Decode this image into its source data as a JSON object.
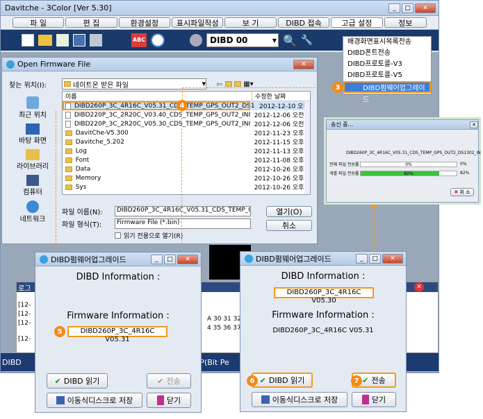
{
  "main": {
    "title": "Davitche - 3Color [Ver 5.30]",
    "menu": [
      "파 일",
      "편 집",
      "환경설정",
      "표시파일작성",
      "보 기",
      "DIBD 접속",
      "고급 설정",
      "정보"
    ],
    "dibd_label": "DIBD 00",
    "dropdown": [
      "배경화면표시목록전송",
      "DIBD폰트전송",
      "DIBD프로토콜-V3",
      "DIBD프로토콜-V5",
      "DIBD펌웨어업그레이드"
    ],
    "log_label": "로그",
    "log_lines": [
      "[12-",
      "[12-",
      "[12-",
      "[12-"
    ],
    "log_hex": [
      "A 30 31 32 33",
      "4 35 36 37 38"
    ],
    "status_left": "DIBD",
    "status_right": "PP(Bit Pe"
  },
  "open": {
    "title": "Open Firmware File",
    "look_in_label": "찾는 위치(I):",
    "look_in_value": "네이트온 받은 파일",
    "col_name": "이름",
    "col_date": "수정한 날짜",
    "files": [
      {
        "name": "DIBD260P_3C_4R16C_V05.31_CDS_TEMP_GPS_OUT2_DS1302_IN...",
        "date": "2012-12-10 오전",
        "kind": "file"
      },
      {
        "name": "DIBD220P_3C_2R20C_V03.40_CDS_TEMP_GPS_OUT2_IN8_DS130...",
        "date": "2012-12-06 오전 1",
        "kind": "file"
      },
      {
        "name": "DIBD220P_3C_2R20C_V05.30_CDS_TEMP_GPS_OUT2_IN8_DS130...",
        "date": "2012-12-06 오전 1",
        "kind": "file"
      },
      {
        "name": "DavitChe-V5.300",
        "date": "2012-11-23 오후 1",
        "kind": "folder"
      },
      {
        "name": "Davitche_5.202",
        "date": "2012-11-15 오후 1",
        "kind": "folder"
      },
      {
        "name": "Log",
        "date": "2012-11-13 오후 8",
        "kind": "folder"
      },
      {
        "name": "Font",
        "date": "2012-11-08 오후 1",
        "kind": "folder"
      },
      {
        "name": "Data",
        "date": "2012-10-26 오후 2",
        "kind": "folder"
      },
      {
        "name": "Memory",
        "date": "2012-10-26 오후 2",
        "kind": "folder"
      },
      {
        "name": "Sys",
        "date": "2012-10-26 오후 2",
        "kind": "folder"
      }
    ],
    "places": [
      "최근 위치",
      "바탕 화면",
      "라이브러리",
      "컴퓨터",
      "네트워크"
    ],
    "filename_label": "파일 이름(N):",
    "filename_value": "DIBD260P_3C_4R16C_V05.31_CDS_TEMP_GPS_",
    "filetype_label": "파일 형식(T):",
    "filetype_value": "Firmware File (*.bin)",
    "readonly_label": "읽기 전용으로 열기(R)",
    "open_btn": "열기(O)",
    "cancel_btn": "취소"
  },
  "progress": {
    "title": "송신 중...",
    "file": "DIBD260P_3C_4R16C_V05.31_CDS_TEMP_GPS_OUT2_DS1302_IN",
    "total_label": "전체 파일 전송률",
    "total_pct": "0%",
    "total_right": "0%",
    "each_label": "개별 파일 전송률",
    "each_pct": "82%",
    "each_right": "82%",
    "each_value": 0.82,
    "cancel": "취 소"
  },
  "upgrade": {
    "title": "DIBD펌웨어업그레이드",
    "dibd_info": "DIBD Information :",
    "fw_info": "Firmware Information :",
    "read_btn": "DIBD 읽기",
    "send_btn": "전송",
    "save_btn": "이동식디스크로 저장",
    "close_btn": "닫기"
  },
  "left": {
    "fw_version": "DIBD260P_3C_4R16C V05.31"
  },
  "right": {
    "dibd_version": "DIBD260P_3C_4R16C V05.30",
    "fw_version": "DIBD260P_3C_4R16C V05.31"
  },
  "markers": {
    "m3": "3",
    "m4": "4",
    "m5": "5",
    "m6": "6",
    "m7": "7"
  }
}
